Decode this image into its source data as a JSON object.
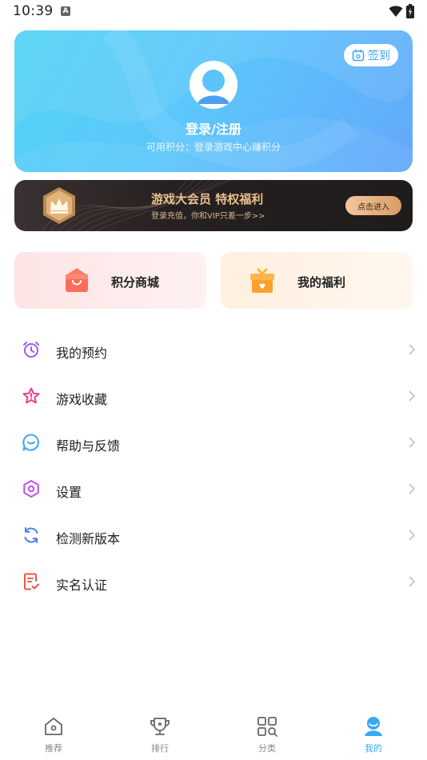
{
  "status_bar": {
    "time": "10:39",
    "notification_icon": "A"
  },
  "profile": {
    "signin_label": "签到",
    "login_label": "登录/注册",
    "points_label": "可用积分：登录游戏中心赚积分"
  },
  "vip": {
    "title": "游戏大会员 特权福利",
    "subtitle": "登录充值，你和VIP只差一步>>",
    "enter_label": "点击进入"
  },
  "quick_cards": [
    {
      "label": "积分商城",
      "icon": "shop-bag-icon"
    },
    {
      "label": "我的福利",
      "icon": "gift-box-icon"
    }
  ],
  "menu": [
    {
      "label": "我的预约",
      "icon": "alarm-clock-icon"
    },
    {
      "label": "游戏收藏",
      "icon": "star-icon"
    },
    {
      "label": "帮助与反馈",
      "icon": "chat-bubble-icon"
    },
    {
      "label": "设置",
      "icon": "settings-hexagon-icon"
    },
    {
      "label": "检测新版本",
      "icon": "refresh-icon"
    },
    {
      "label": "实名认证",
      "icon": "id-document-icon"
    }
  ],
  "bottom_nav": [
    {
      "label": "推荐",
      "icon": "home-icon",
      "active": false
    },
    {
      "label": "排行",
      "icon": "trophy-icon",
      "active": false
    },
    {
      "label": "分类",
      "icon": "category-grid-icon",
      "active": false
    },
    {
      "label": "我的",
      "icon": "user-icon",
      "active": true
    }
  ],
  "colors": {
    "accent": "#3aa7f2",
    "vip_gold": "#e9c08e",
    "card_gradient_start": "#53d3f5",
    "card_gradient_end": "#63a8fb"
  }
}
